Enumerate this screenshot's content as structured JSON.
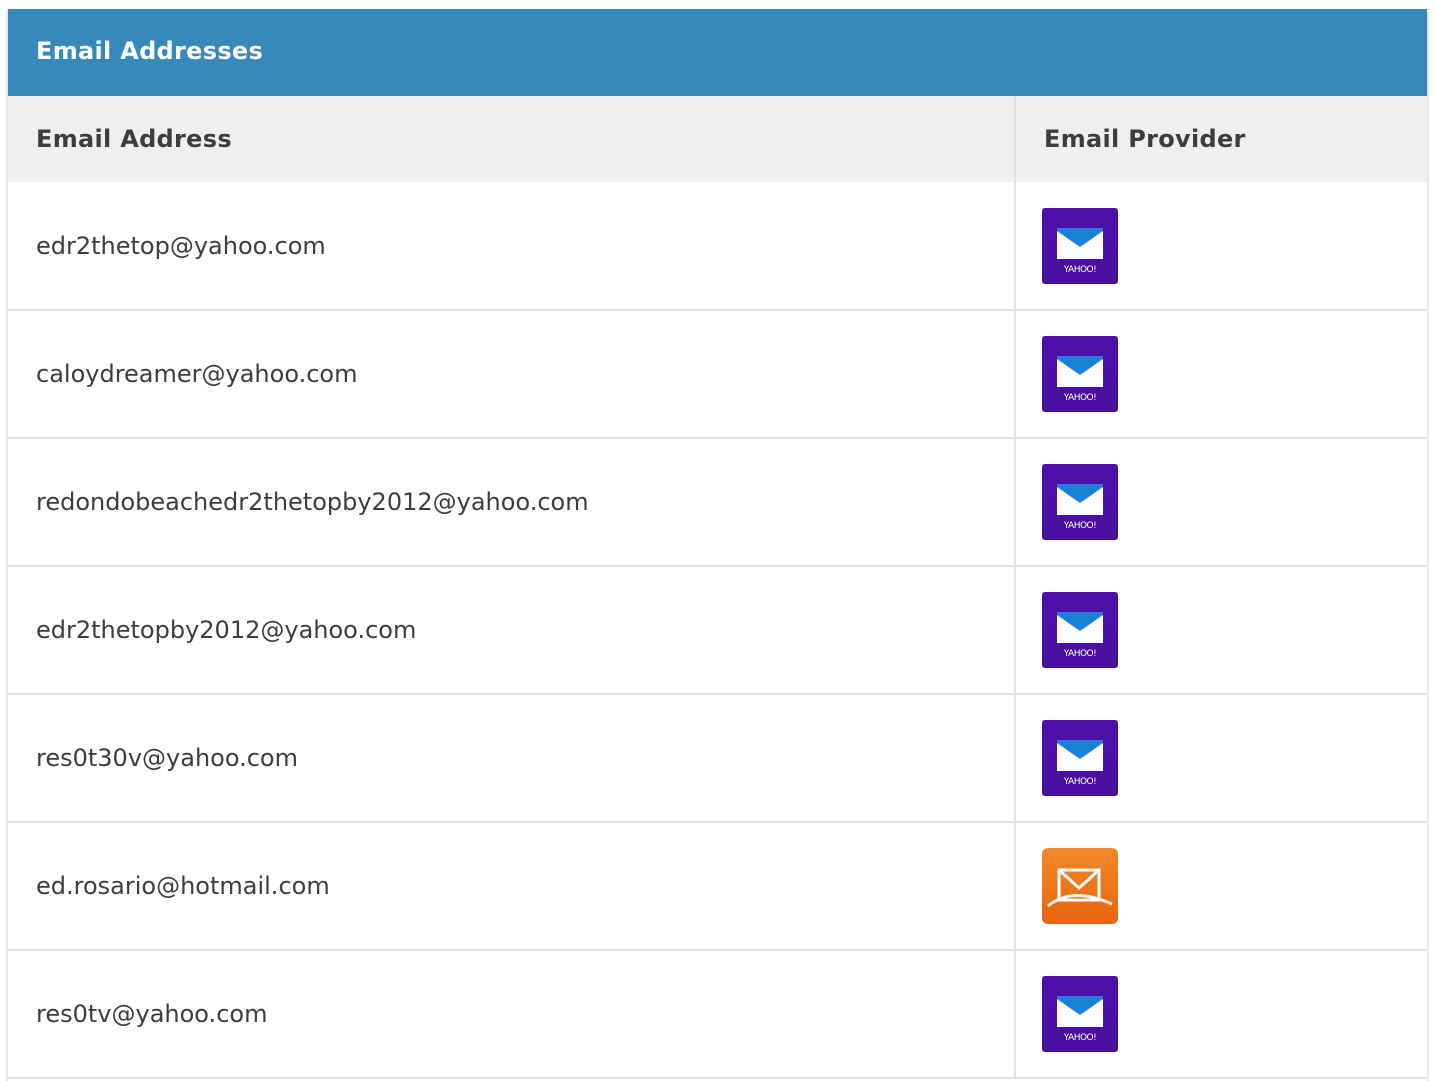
{
  "panel": {
    "title": "Email Addresses"
  },
  "table": {
    "headers": {
      "email": "Email Address",
      "provider": "Email Provider"
    },
    "rows": [
      {
        "email": "edr2thetop@yahoo.com",
        "provider_icon": "yahoo-mail-icon"
      },
      {
        "email": "caloydreamer@yahoo.com",
        "provider_icon": "yahoo-mail-icon"
      },
      {
        "email": "redondobeachedr2thetopby2012@yahoo.com",
        "provider_icon": "yahoo-mail-icon"
      },
      {
        "email": "edr2thetopby2012@yahoo.com",
        "provider_icon": "yahoo-mail-icon"
      },
      {
        "email": "res0t30v@yahoo.com",
        "provider_icon": "yahoo-mail-icon"
      },
      {
        "email": "ed.rosario@hotmail.com",
        "provider_icon": "hotmail-icon"
      },
      {
        "email": "res0tv@yahoo.com",
        "provider_icon": "yahoo-mail-icon"
      }
    ]
  },
  "icons": {
    "yahoo_label": "YAHOO!"
  },
  "colors": {
    "header_bg": "#3689b9",
    "yahoo_bg": "#4b0fa3",
    "hotmail_bg": "#ef7a1a"
  }
}
